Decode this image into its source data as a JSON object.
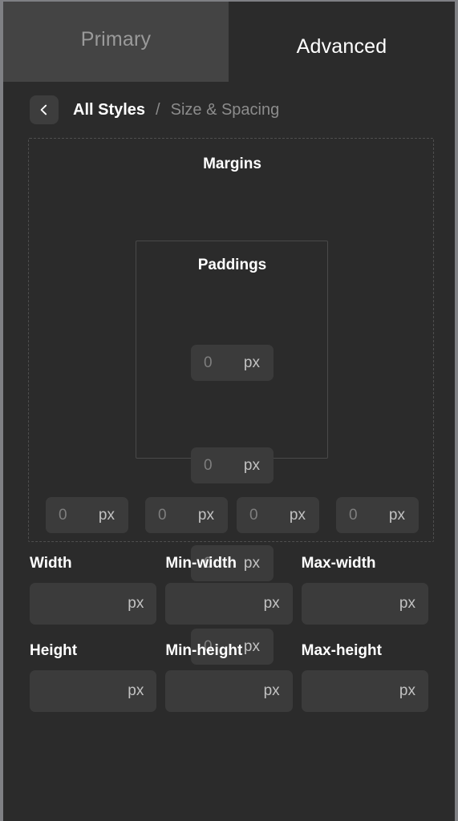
{
  "tabs": [
    {
      "id": "primary",
      "label": "Primary",
      "active": false
    },
    {
      "id": "advanced",
      "label": "Advanced",
      "active": true
    }
  ],
  "breadcrumb": {
    "back_icon": "chevron-left-icon",
    "parent": "All Styles",
    "separator": "/",
    "current": "Size & Spacing"
  },
  "spacing": {
    "margins_label": "Margins",
    "paddings_label": "Paddings",
    "unit": "px",
    "margin_top": {
      "value": "0",
      "unit": "px"
    },
    "margin_right": {
      "value": "0",
      "unit": "px"
    },
    "margin_bottom": {
      "value": "0",
      "unit": "px"
    },
    "margin_left": {
      "value": "0",
      "unit": "px"
    },
    "padding_top": {
      "value": "0",
      "unit": "px"
    },
    "padding_right": {
      "value": "0",
      "unit": "px"
    },
    "padding_bottom": {
      "value": "0",
      "unit": "px"
    },
    "padding_left": {
      "value": "0",
      "unit": "px"
    }
  },
  "size": {
    "rows": [
      {
        "fields": [
          {
            "label": "Width",
            "value": "",
            "unit": "px"
          },
          {
            "label": "Min-width",
            "value": "",
            "unit": "px"
          },
          {
            "label": "Max-width",
            "value": "",
            "unit": "px"
          }
        ]
      },
      {
        "fields": [
          {
            "label": "Height",
            "value": "",
            "unit": "px"
          },
          {
            "label": "Min-height",
            "value": "",
            "unit": "px"
          },
          {
            "label": "Max-height",
            "value": "",
            "unit": "px"
          }
        ]
      }
    ]
  },
  "colors": {
    "panel_bg": "#2b2b2b",
    "tab_inactive_bg": "#444444",
    "tab_active_bg": "#2b2b2b",
    "input_bg": "#3b3b3b",
    "text_primary": "#ffffff",
    "text_muted": "#8c8c8c",
    "placeholder": "#7e7e7e",
    "frame_border": "#7f8084"
  }
}
